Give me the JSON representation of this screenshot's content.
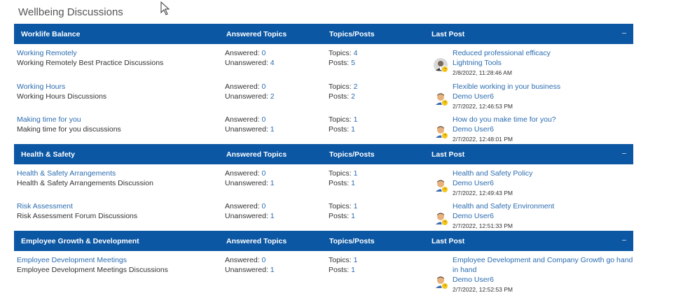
{
  "page": {
    "title": "Wellbeing Discussions"
  },
  "columns": {
    "answered": "Answered Topics",
    "topics": "Topics/Posts",
    "last": "Last Post"
  },
  "labels": {
    "answered": "Answered:",
    "unanswered": "Unanswered:",
    "topics": "Topics:",
    "posts": "Posts:"
  },
  "categories": [
    {
      "name": "Worklife Balance",
      "forums": [
        {
          "title": "Working Remotely",
          "desc": "Working Remotely Best Practice Discussions",
          "answered": "0",
          "unanswered": "4",
          "topics": "4",
          "posts": "5",
          "last_title": "Reduced professional efficacy",
          "last_user": "Lightning Tools",
          "last_date": "2/8/2022, 11:28:46 AM",
          "avatar": "man-photo-icon"
        },
        {
          "title": "Working Hours",
          "desc": "Working Hours Discussions",
          "answered": "0",
          "unanswered": "2",
          "topics": "2",
          "posts": "2",
          "last_title": "Flexible working in your business",
          "last_user": "Demo User6",
          "last_date": "2/7/2022, 12:46:53 PM",
          "avatar": "user-avatar-icon"
        },
        {
          "title": "Making time for you",
          "desc": "Making time for you discussions",
          "answered": "0",
          "unanswered": "1",
          "topics": "1",
          "posts": "1",
          "last_title": "How do you make time for you?",
          "last_user": "Demo User6",
          "last_date": "2/7/2022, 12:48:01 PM",
          "avatar": "user-avatar-icon"
        }
      ]
    },
    {
      "name": "Health & Safety",
      "forums": [
        {
          "title": "Health & Safety Arrangements",
          "desc": "Health & Safety Arrangements Discussion",
          "answered": "0",
          "unanswered": "1",
          "topics": "1",
          "posts": "1",
          "last_title": "Health and Safety Policy",
          "last_user": "Demo User6",
          "last_date": "2/7/2022, 12:49:43 PM",
          "avatar": "user-avatar-icon"
        },
        {
          "title": "Risk Assessment",
          "desc": "Risk Assessment Forum Discussions",
          "answered": "0",
          "unanswered": "1",
          "topics": "1",
          "posts": "1",
          "last_title": "Health and Safety Environment",
          "last_user": "Demo User6",
          "last_date": "2/7/2022, 12:51:33 PM",
          "avatar": "user-avatar-icon"
        }
      ]
    },
    {
      "name": "Employee Growth & Development",
      "forums": [
        {
          "title": "Employee Development Meetings",
          "desc": "Employee Development Meetings Discussions",
          "answered": "0",
          "unanswered": "1",
          "topics": "1",
          "posts": "1",
          "last_title": "Employee Development and Company Growth go hand in hand",
          "last_user": "Demo User6",
          "last_date": "2/7/2022, 12:52:53 PM",
          "avatar": "user-avatar-icon"
        }
      ]
    }
  ]
}
